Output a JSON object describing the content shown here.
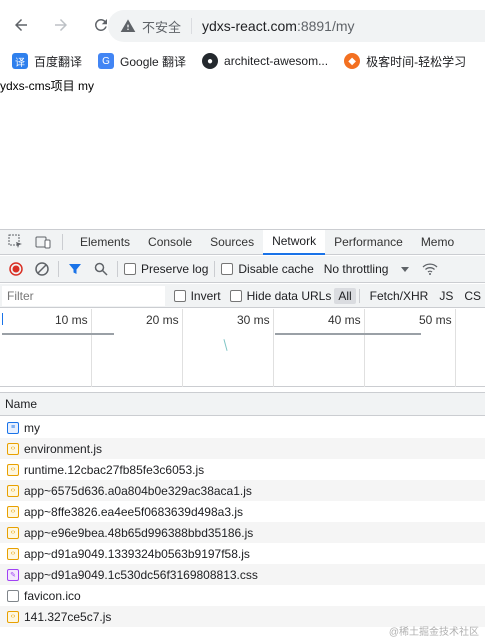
{
  "browser": {
    "insecure_label": "不安全",
    "url_host": "ydxs-react.com",
    "url_rest": ":8891/my"
  },
  "bookmarks": [
    {
      "label": "百度翻译",
      "icon": "translate-icon",
      "color": "#2f80ed"
    },
    {
      "label": "Google 翻译",
      "icon": "google-translate-icon",
      "color": "#4285f4"
    },
    {
      "label": "architect-awesom...",
      "icon": "github-icon",
      "color": "#24292e"
    },
    {
      "label": "极客时间-轻松学习",
      "icon": "geektime-icon",
      "color": "#f37021"
    }
  ],
  "page": {
    "text": "ydxs-cms项目 my"
  },
  "devtools": {
    "tabs": [
      "Elements",
      "Console",
      "Sources",
      "Network",
      "Performance",
      "Memo"
    ],
    "active_tab": "Network",
    "toolbar": {
      "preserve_log": "Preserve log",
      "disable_cache": "Disable cache",
      "throttling": "No throttling"
    },
    "filter": {
      "placeholder": "Filter",
      "invert": "Invert",
      "hide_data_urls": "Hide data URLs",
      "types": [
        "All",
        "Fetch/XHR",
        "JS",
        "CS"
      ]
    },
    "timeline_ticks": [
      "10 ms",
      "20 ms",
      "30 ms",
      "40 ms",
      "50 ms"
    ],
    "table": {
      "header": "Name",
      "rows": [
        {
          "name": "my",
          "type": "doc"
        },
        {
          "name": "environment.js",
          "type": "script"
        },
        {
          "name": "runtime.12cbac27fb85fe3c6053.js",
          "type": "script"
        },
        {
          "name": "app~6575d636.a0a804b0e329ac38aca1.js",
          "type": "script"
        },
        {
          "name": "app~8ffe3826.ea4ee5f0683639d498a3.js",
          "type": "script"
        },
        {
          "name": "app~e96e9bea.48b65d996388bbd35186.js",
          "type": "script"
        },
        {
          "name": "app~d91a9049.1339324b0563b9197f58.js",
          "type": "script"
        },
        {
          "name": "app~d91a9049.1c530dc56f3169808813.css",
          "type": "css"
        },
        {
          "name": "favicon.ico",
          "type": "other"
        },
        {
          "name": "141.327ce5c7.js",
          "type": "script"
        }
      ]
    }
  },
  "watermark": "@稀土掘金技术社区"
}
